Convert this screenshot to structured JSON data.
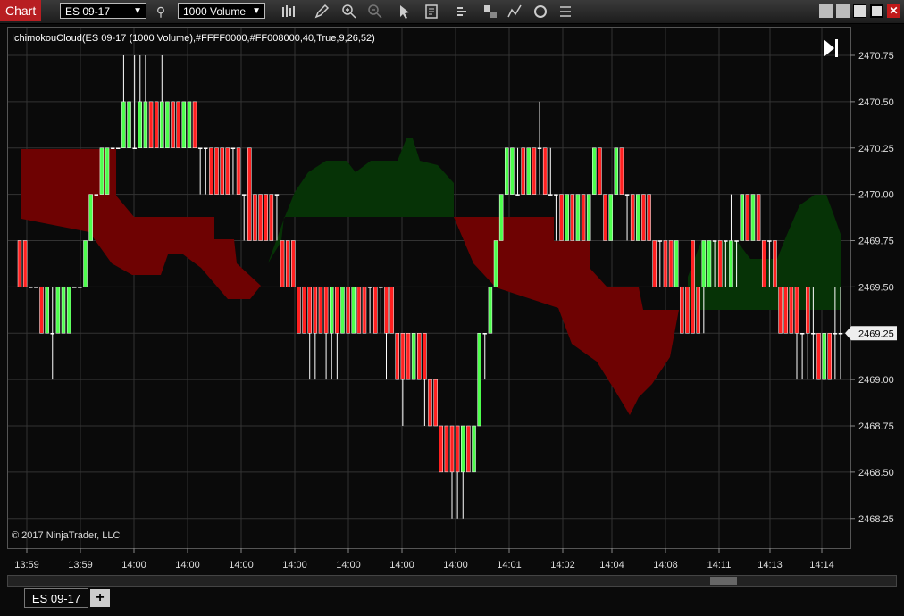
{
  "window": {
    "title": "Chart",
    "instrument": "ES 09-17",
    "interval": "1000 Volume",
    "tools": [
      "bar-chart-icon",
      "pencil-icon",
      "zoom-in-icon",
      "zoom-out-icon",
      "pointer-icon",
      "data-box-icon",
      "strategies-icon",
      "templates-icon",
      "indicators-icon",
      "refresh-icon",
      "properties-icon"
    ]
  },
  "indicator_label": "IchimokouCloud(ES 09-17 (1000 Volume),#FFFF0000,#FF008000,40,True,9,26,52)",
  "copyright": "© 2017 NinjaTrader, LLC",
  "bottom_tab": {
    "label": "ES 09-17",
    "add": "+"
  },
  "colors": {
    "bull": "#4dff4d",
    "bear": "#ff2020",
    "cloud_bear": "#6e0202",
    "cloud_bull": "#063306",
    "accent": "#b81e22"
  },
  "chart_data": {
    "type": "candlestick",
    "ylim": [
      2468.125,
      2470.875
    ],
    "y_ticks": [
      "2470.75",
      "2470.50",
      "2470.25",
      "2470.00",
      "2469.75",
      "2469.50",
      "2469.25",
      "2469.00",
      "2468.75",
      "2468.50",
      "2468.25"
    ],
    "current_price": "2469.25",
    "x_ticks": [
      "13:59",
      "13:59",
      "14:00",
      "14:00",
      "14:00",
      "14:00",
      "14:00",
      "14:00",
      "14:00",
      "14:01",
      "14:02",
      "14:04",
      "14:08",
      "14:11",
      "14:13",
      "14:14"
    ],
    "candles_ohlc": [
      [
        2469.75,
        2469.75,
        2469.5,
        2469.5
      ],
      [
        2469.75,
        2469.75,
        2469.5,
        2469.5
      ],
      [
        2469.5,
        2469.5,
        2469.5,
        2469.5
      ],
      [
        2469.5,
        2469.5,
        2469.5,
        2469.5
      ],
      [
        2469.5,
        2469.5,
        2469.25,
        2469.25
      ],
      [
        2469.25,
        2469.5,
        2469.25,
        2469.5
      ],
      [
        2469.25,
        2469.5,
        2469.0,
        2469.25
      ],
      [
        2469.25,
        2469.5,
        2469.25,
        2469.5
      ],
      [
        2469.25,
        2469.5,
        2469.25,
        2469.5
      ],
      [
        2469.25,
        2469.5,
        2469.25,
        2469.5
      ],
      [
        2469.5,
        2469.5,
        2469.5,
        2469.5
      ],
      [
        2469.5,
        2469.5,
        2469.5,
        2469.5
      ],
      [
        2469.5,
        2469.75,
        2469.5,
        2469.75
      ],
      [
        2469.75,
        2470.0,
        2469.75,
        2470.0
      ],
      [
        2470.0,
        2470.0,
        2470.0,
        2470.0
      ],
      [
        2470.0,
        2470.25,
        2470.0,
        2470.25
      ],
      [
        2470.0,
        2470.25,
        2470.0,
        2470.25
      ],
      [
        2470.25,
        2470.25,
        2470.25,
        2470.25
      ],
      [
        2470.25,
        2470.25,
        2470.25,
        2470.25
      ],
      [
        2470.25,
        2470.75,
        2470.25,
        2470.5
      ],
      [
        2470.25,
        2470.5,
        2470.25,
        2470.5
      ],
      [
        2470.25,
        2470.75,
        2470.25,
        2470.25
      ],
      [
        2470.25,
        2470.75,
        2470.25,
        2470.5
      ],
      [
        2470.25,
        2470.75,
        2470.25,
        2470.5
      ],
      [
        2470.5,
        2470.5,
        2470.25,
        2470.25
      ],
      [
        2470.5,
        2470.5,
        2470.25,
        2470.25
      ],
      [
        2470.25,
        2470.75,
        2470.25,
        2470.5
      ],
      [
        2470.25,
        2470.5,
        2470.25,
        2470.5
      ],
      [
        2470.5,
        2470.5,
        2470.25,
        2470.25
      ],
      [
        2470.5,
        2470.5,
        2470.25,
        2470.25
      ],
      [
        2470.25,
        2470.5,
        2470.25,
        2470.5
      ],
      [
        2470.25,
        2470.5,
        2470.25,
        2470.5
      ],
      [
        2470.5,
        2470.5,
        2470.25,
        2470.25
      ],
      [
        2470.25,
        2470.25,
        2470.0,
        2470.25
      ],
      [
        2470.25,
        2470.25,
        2470.0,
        2470.25
      ],
      [
        2470.25,
        2470.25,
        2470.0,
        2470.0
      ],
      [
        2470.25,
        2470.25,
        2470.0,
        2470.0
      ],
      [
        2470.25,
        2470.25,
        2470.0,
        2470.0
      ],
      [
        2470.25,
        2470.25,
        2470.0,
        2470.0
      ],
      [
        2470.25,
        2470.25,
        2470.0,
        2470.25
      ],
      [
        2470.25,
        2470.25,
        2470.0,
        2470.0
      ],
      [
        2470.0,
        2470.0,
        2469.75,
        2470.0
      ],
      [
        2470.25,
        2470.25,
        2469.75,
        2469.75
      ],
      [
        2470.0,
        2470.0,
        2469.75,
        2469.75
      ],
      [
        2470.0,
        2470.0,
        2469.75,
        2469.75
      ],
      [
        2470.0,
        2470.0,
        2469.75,
        2469.75
      ],
      [
        2470.0,
        2470.0,
        2469.75,
        2469.75
      ],
      [
        2470.0,
        2470.0,
        2469.75,
        2470.0
      ],
      [
        2469.75,
        2469.75,
        2469.5,
        2469.5
      ],
      [
        2469.75,
        2469.75,
        2469.5,
        2469.5
      ],
      [
        2469.75,
        2469.75,
        2469.5,
        2469.5
      ],
      [
        2469.5,
        2469.5,
        2469.25,
        2469.25
      ],
      [
        2469.5,
        2469.5,
        2469.25,
        2469.25
      ],
      [
        2469.5,
        2469.5,
        2469.0,
        2469.25
      ],
      [
        2469.5,
        2469.5,
        2469.0,
        2469.25
      ],
      [
        2469.5,
        2469.5,
        2469.25,
        2469.25
      ],
      [
        2469.5,
        2469.5,
        2469.0,
        2469.25
      ],
      [
        2469.25,
        2469.5,
        2469.0,
        2469.5
      ],
      [
        2469.5,
        2469.5,
        2469.0,
        2469.25
      ],
      [
        2469.25,
        2469.5,
        2469.25,
        2469.5
      ],
      [
        2469.5,
        2469.5,
        2469.25,
        2469.25
      ],
      [
        2469.25,
        2469.5,
        2469.25,
        2469.5
      ],
      [
        2469.5,
        2469.5,
        2469.25,
        2469.25
      ],
      [
        2469.5,
        2469.5,
        2469.25,
        2469.25
      ],
      [
        2469.5,
        2469.5,
        2469.25,
        2469.5
      ],
      [
        2469.5,
        2469.5,
        2469.25,
        2469.25
      ],
      [
        2469.5,
        2469.5,
        2469.25,
        2469.5
      ],
      [
        2469.5,
        2469.5,
        2469.0,
        2469.25
      ],
      [
        2469.5,
        2469.5,
        2469.25,
        2469.25
      ],
      [
        2469.25,
        2469.25,
        2469.0,
        2469.0
      ],
      [
        2469.25,
        2469.25,
        2468.75,
        2469.0
      ],
      [
        2469.25,
        2469.25,
        2469.0,
        2469.0
      ],
      [
        2469.0,
        2469.25,
        2469.0,
        2469.25
      ],
      [
        2469.25,
        2469.25,
        2469.0,
        2469.0
      ],
      [
        2469.25,
        2469.25,
        2468.75,
        2469.0
      ],
      [
        2469.0,
        2469.0,
        2468.75,
        2468.75
      ],
      [
        2469.0,
        2469.0,
        2468.75,
        2468.75
      ],
      [
        2468.75,
        2468.75,
        2468.5,
        2468.5
      ],
      [
        2468.75,
        2468.75,
        2468.5,
        2468.5
      ],
      [
        2468.75,
        2468.75,
        2468.25,
        2468.5
      ],
      [
        2468.75,
        2468.75,
        2468.25,
        2468.5
      ],
      [
        2468.5,
        2468.75,
        2468.25,
        2468.75
      ],
      [
        2468.75,
        2468.75,
        2468.5,
        2468.5
      ],
      [
        2468.5,
        2468.75,
        2468.5,
        2468.75
      ],
      [
        2468.75,
        2469.25,
        2468.75,
        2469.25
      ],
      [
        2469.25,
        2469.25,
        2469.0,
        2469.25
      ],
      [
        2469.25,
        2469.5,
        2469.25,
        2469.5
      ],
      [
        2469.5,
        2469.75,
        2469.5,
        2469.75
      ],
      [
        2469.75,
        2470.0,
        2469.75,
        2470.0
      ],
      [
        2470.0,
        2470.25,
        2470.0,
        2470.25
      ],
      [
        2470.0,
        2470.25,
        2470.0,
        2470.25
      ],
      [
        2470.0,
        2470.25,
        2470.0,
        2470.0
      ],
      [
        2470.25,
        2470.25,
        2470.0,
        2470.0
      ],
      [
        2470.0,
        2470.25,
        2470.0,
        2470.25
      ],
      [
        2470.25,
        2470.25,
        2470.0,
        2470.0
      ],
      [
        2470.25,
        2470.5,
        2470.0,
        2470.25
      ],
      [
        2470.25,
        2470.25,
        2470.0,
        2470.0
      ],
      [
        2470.0,
        2470.25,
        2470.0,
        2470.0
      ],
      [
        2470.0,
        2470.0,
        2469.75,
        2470.0
      ],
      [
        2470.0,
        2470.0,
        2469.75,
        2469.75
      ],
      [
        2469.75,
        2470.0,
        2469.75,
        2470.0
      ],
      [
        2470.0,
        2470.0,
        2469.75,
        2469.75
      ],
      [
        2469.75,
        2470.0,
        2469.75,
        2470.0
      ],
      [
        2470.0,
        2470.0,
        2469.75,
        2469.75
      ],
      [
        2469.75,
        2470.0,
        2469.75,
        2470.0
      ],
      [
        2470.0,
        2470.25,
        2470.0,
        2470.25
      ],
      [
        2470.25,
        2470.25,
        2470.0,
        2470.0
      ],
      [
        2470.0,
        2470.0,
        2469.75,
        2469.75
      ],
      [
        2469.75,
        2470.0,
        2469.75,
        2470.0
      ],
      [
        2470.0,
        2470.25,
        2470.0,
        2470.25
      ],
      [
        2470.25,
        2470.25,
        2470.0,
        2470.0
      ],
      [
        2470.0,
        2470.0,
        2469.75,
        2470.0
      ],
      [
        2470.0,
        2470.0,
        2469.75,
        2469.75
      ],
      [
        2469.75,
        2470.0,
        2469.75,
        2470.0
      ],
      [
        2470.0,
        2470.0,
        2469.75,
        2469.75
      ],
      [
        2470.0,
        2470.0,
        2469.75,
        2469.75
      ],
      [
        2469.75,
        2469.75,
        2469.5,
        2469.5
      ],
      [
        2469.75,
        2469.75,
        2469.5,
        2469.75
      ],
      [
        2469.75,
        2469.75,
        2469.5,
        2469.5
      ],
      [
        2469.75,
        2469.75,
        2469.5,
        2469.5
      ],
      [
        2469.5,
        2469.75,
        2469.5,
        2469.75
      ],
      [
        2469.5,
        2469.5,
        2469.25,
        2469.25
      ],
      [
        2469.5,
        2469.5,
        2469.25,
        2469.25
      ],
      [
        2469.75,
        2469.75,
        2469.25,
        2469.25
      ],
      [
        2469.5,
        2469.5,
        2469.25,
        2469.25
      ],
      [
        2469.5,
        2469.75,
        2469.25,
        2469.75
      ],
      [
        2469.5,
        2469.75,
        2469.5,
        2469.75
      ],
      [
        2469.75,
        2469.75,
        2469.5,
        2469.75
      ],
      [
        2469.75,
        2469.75,
        2469.5,
        2469.5
      ],
      [
        2469.75,
        2469.75,
        2469.5,
        2469.75
      ],
      [
        2469.5,
        2470.0,
        2469.5,
        2469.75
      ],
      [
        2469.75,
        2469.75,
        2469.5,
        2469.75
      ],
      [
        2469.75,
        2470.0,
        2469.75,
        2470.0
      ],
      [
        2470.0,
        2470.0,
        2469.75,
        2469.75
      ],
      [
        2469.75,
        2470.0,
        2469.75,
        2470.0
      ],
      [
        2470.0,
        2470.0,
        2469.75,
        2469.75
      ],
      [
        2469.75,
        2469.75,
        2469.5,
        2469.5
      ],
      [
        2469.75,
        2469.75,
        2469.5,
        2469.75
      ],
      [
        2469.75,
        2469.75,
        2469.5,
        2469.5
      ],
      [
        2469.5,
        2469.5,
        2469.25,
        2469.25
      ],
      [
        2469.5,
        2469.5,
        2469.25,
        2469.25
      ],
      [
        2469.5,
        2469.5,
        2469.25,
        2469.25
      ],
      [
        2469.5,
        2469.5,
        2469.0,
        2469.25
      ],
      [
        2469.25,
        2469.25,
        2469.0,
        2469.25
      ],
      [
        2469.5,
        2469.5,
        2469.0,
        2469.25
      ],
      [
        2469.25,
        2469.5,
        2469.0,
        2469.25
      ],
      [
        2469.25,
        2469.25,
        2469.0,
        2469.0
      ],
      [
        2469.0,
        2469.25,
        2469.0,
        2469.25
      ],
      [
        2469.25,
        2469.25,
        2469.0,
        2469.0
      ],
      [
        2469.25,
        2469.5,
        2469.0,
        2469.25
      ],
      [
        2469.25,
        2469.5,
        2469.0,
        2469.25
      ]
    ],
    "cloud_bear_1": {
      "x0": 2,
      "x1": 42,
      "top": [
        2470.25,
        2470.25,
        2470.25,
        2470.25,
        2470.25,
        2470.25,
        2470.25,
        2470.25,
        2470.0,
        2470.0,
        2470.0,
        2470.0,
        2470.0,
        2470.0,
        2470.0,
        2469.75,
        2469.75,
        2469.75,
        2469.75,
        2469.75,
        2469.75,
        2469.75,
        2469.75,
        2469.75,
        2469.75,
        2469.75,
        2469.75,
        2469.75,
        2469.75,
        2469.75,
        2469.75,
        2469.75,
        2469.75,
        2469.75,
        2469.75,
        2469.75,
        2469.75,
        2469.5,
        2469.5,
        2469.5,
        2469.5
      ],
      "bottom": [
        2469.875,
        2469.875,
        2469.875,
        2469.875,
        2469.875,
        2469.875,
        2469.875,
        2469.875,
        2469.875,
        2469.875,
        2469.875,
        2469.875,
        2469.625,
        2469.625,
        2469.625,
        2469.625,
        2469.625,
        2469.625,
        2469.625,
        2469.625,
        2469.5,
        2469.5,
        2469.5,
        2469.5,
        2469.625,
        2469.625,
        2469.625,
        2469.625,
        2469.625,
        2469.625,
        2469.625,
        2469.625,
        2469.5,
        2469.5,
        2469.5,
        2469.5,
        2469.4,
        2469.4,
        2469.4,
        2469.4,
        2469.4
      ]
    }
  }
}
